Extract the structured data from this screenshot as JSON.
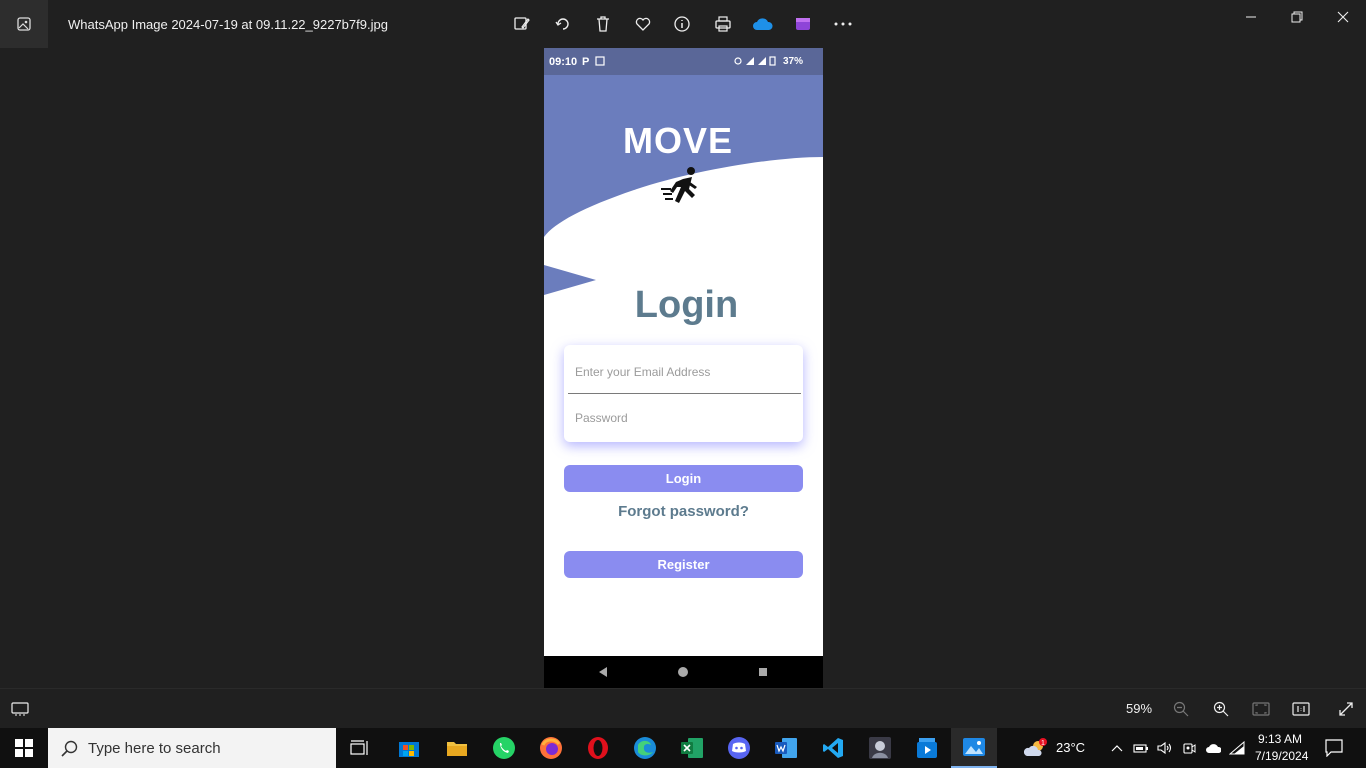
{
  "titlebar": {
    "filename": "WhatsApp Image 2024-07-19 at 09.11.22_9227b7f9.jpg",
    "tools": [
      "edit-icon",
      "rotate-icon",
      "delete-icon",
      "favorite-icon",
      "info-icon",
      "print-icon",
      "onedrive-icon",
      "clipchamp-icon",
      "more-icon"
    ]
  },
  "phone": {
    "status": {
      "time": "09:10",
      "p": "P",
      "battery": "37%"
    },
    "brand": "MOVE",
    "login_title": "Login",
    "email_placeholder": "Enter your Email Address",
    "password_placeholder": "Password",
    "login_button": "Login",
    "forgot": "Forgot password?",
    "register_button": "Register",
    "colors": {
      "hero": "#6b7dbd",
      "button": "#8a8cf0",
      "title": "#5d7b8e"
    }
  },
  "photobar": {
    "zoom": "59%"
  },
  "taskbar": {
    "search_placeholder": "Type here to search",
    "temperature": "23°C",
    "weather_badge": "1",
    "time": "9:13 AM",
    "date": "7/19/2024"
  }
}
